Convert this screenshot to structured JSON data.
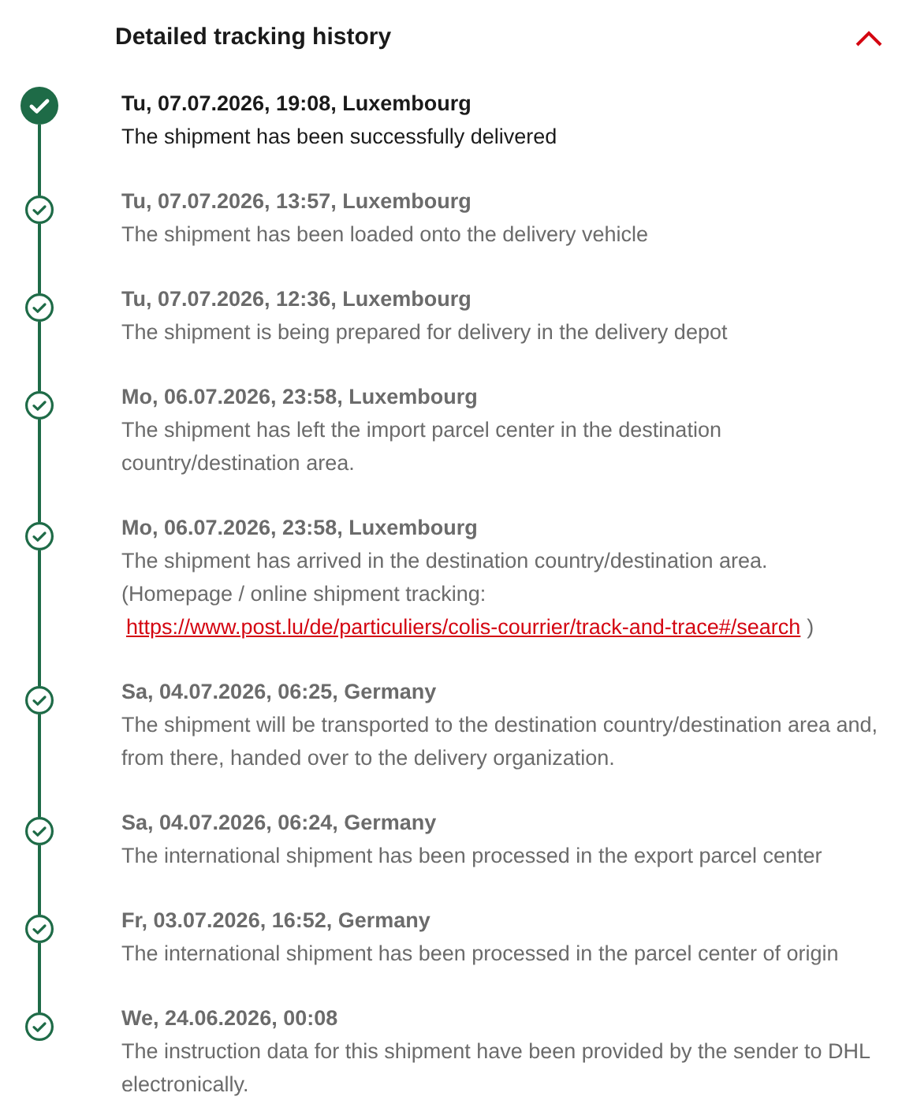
{
  "header": {
    "title": "Detailed tracking history",
    "expanded": true
  },
  "events": [
    {
      "title": "Tu, 07.07.2026, 19:08, Luxembourg",
      "description": "The shipment has been successfully delivered",
      "current": true
    },
    {
      "title": "Tu, 07.07.2026, 13:57, Luxembourg",
      "description": "The shipment has been loaded onto the delivery vehicle",
      "current": false
    },
    {
      "title": "Tu, 07.07.2026, 12:36, Luxembourg",
      "description": "The shipment is being prepared for delivery in the delivery depot",
      "current": false
    },
    {
      "title": "Mo, 06.07.2026, 23:58, Luxembourg",
      "description": "The shipment has left the import parcel center in the destination country/destination area.",
      "current": false
    },
    {
      "title": "Mo, 06.07.2026, 23:58, Luxembourg",
      "description": "The shipment has arrived in the destination country/destination area.",
      "note": "(Homepage / online shipment tracking:",
      "link": "https://www.post.lu/de/particuliers/colis-courrier/track-and-trace#/search",
      "note_end": ")",
      "current": false
    },
    {
      "title": "Sa, 04.07.2026, 06:25, Germany",
      "description": "The shipment will be transported to the destination country/destination area and, from there, handed over to the delivery organization.",
      "current": false
    },
    {
      "title": "Sa, 04.07.2026, 06:24, Germany",
      "description": "The international shipment has been processed in the export parcel center",
      "current": false
    },
    {
      "title": "Fr, 03.07.2026, 16:52, Germany",
      "description": "The international shipment has been processed in the parcel center of origin",
      "current": false
    },
    {
      "title": "We, 24.06.2026, 00:08",
      "description": "The instruction data for this shipment have been provided by the sender to DHL electronically.",
      "current": false
    }
  ]
}
